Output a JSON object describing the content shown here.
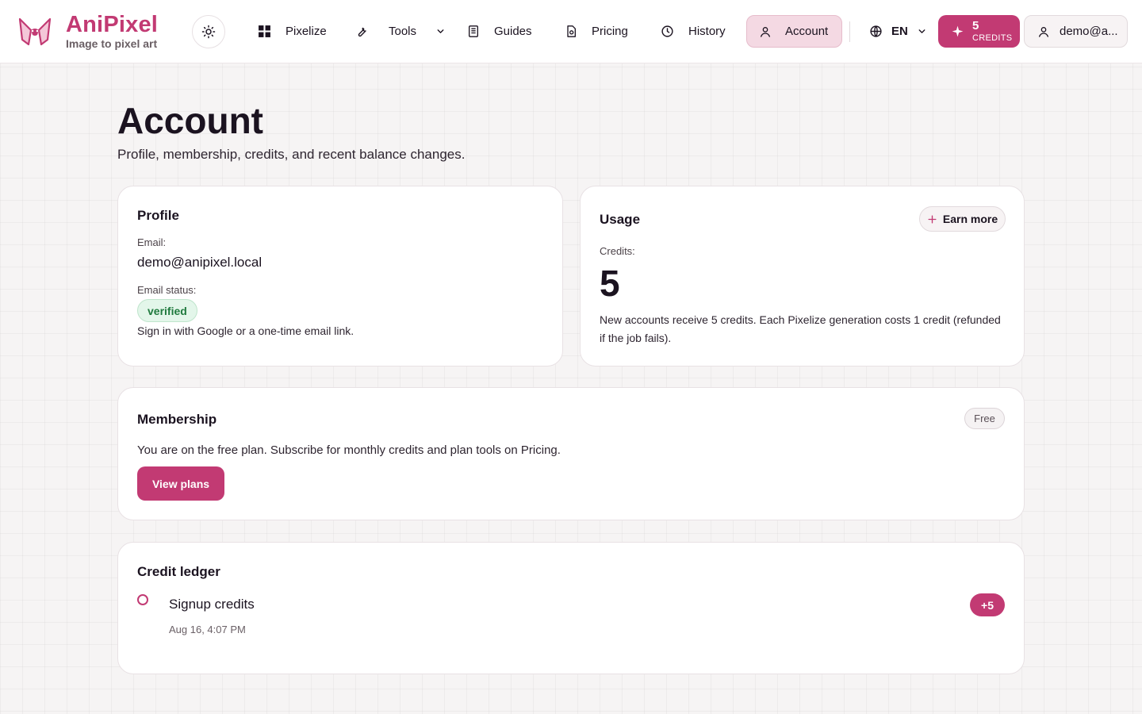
{
  "app": {
    "name": "AniPixel",
    "tagline": "Image to pixel art",
    "brand_color": "#c23a73"
  },
  "nav": {
    "items": [
      {
        "label": "Pixelize",
        "icon": "grid-icon"
      },
      {
        "label": "Tools",
        "icon": "wrench-icon",
        "has_dropdown": true
      },
      {
        "label": "Guides",
        "icon": "document-icon"
      },
      {
        "label": "Pricing",
        "icon": "receipt-icon"
      },
      {
        "label": "History",
        "icon": "clock-icon"
      },
      {
        "label": "Account",
        "icon": "user-icon",
        "active": true
      }
    ],
    "language": "EN",
    "credits": {
      "value": "5",
      "label": "CREDITS"
    },
    "user_label": "demo@a..."
  },
  "page": {
    "title": "Account",
    "subtitle": "Profile, membership, credits, and recent balance changes."
  },
  "profile": {
    "title": "Profile",
    "email_label": "Email:",
    "email_value": "demo@anipixel.local",
    "status_label": "Email status:",
    "status_value": "verified",
    "signin_note": "Sign in with Google or a one-time email link."
  },
  "usage": {
    "title": "Usage",
    "earn_label": "Earn more",
    "credits_label": "Credits:",
    "credits_value": "5",
    "note": "New accounts receive 5 credits. Each Pixelize generation costs 1 credit (refunded if the job fails)."
  },
  "membership": {
    "title": "Membership",
    "plan_badge": "Free",
    "description": "You are on the free plan. Subscribe for monthly credits and plan tools on Pricing.",
    "button_label": "View plans"
  },
  "ledger": {
    "title": "Credit ledger",
    "entries": [
      {
        "title": "Signup credits",
        "time": "Aug 16, 4:07 PM",
        "amount": "+5"
      }
    ]
  }
}
